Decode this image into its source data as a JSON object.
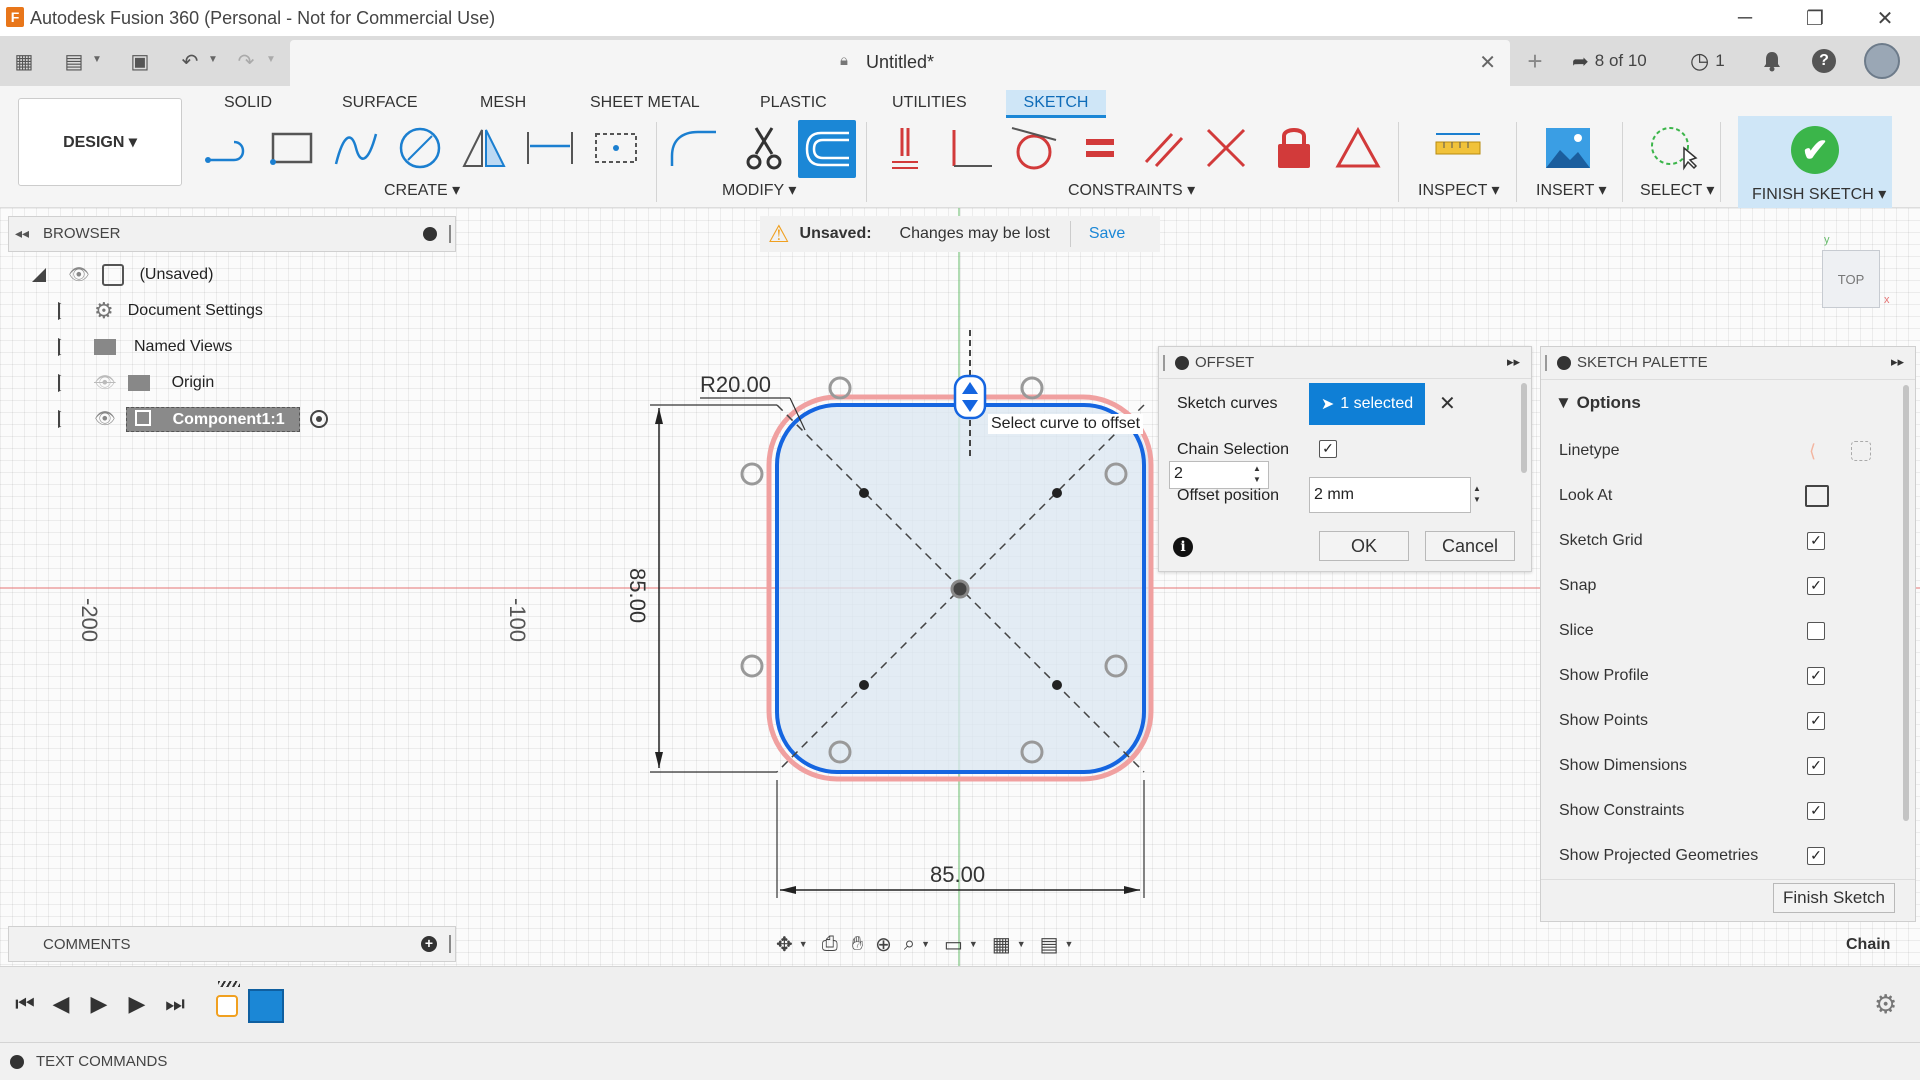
{
  "window": {
    "title": "Autodesk Fusion 360 (Personal - Not for Commercial Use)",
    "logo_letter": "F",
    "minimize": "─",
    "restore": "❐",
    "close": "✕"
  },
  "quick_access": {
    "grid_icon": "▦",
    "file_icon": "▤",
    "save_icon": "▣",
    "undo_icon": "↶",
    "redo_icon": "↷",
    "doc_title": "Untitled*",
    "doc_close": "✕",
    "new_tab": "+",
    "jobs": "8 of 10",
    "jobs_icon": "➦",
    "clock_count": "1",
    "clock_icon": "◷",
    "bell_icon": "🔔",
    "help_icon": "?",
    "avatar_icon": "●"
  },
  "ribbon": {
    "tabs": [
      "SOLID",
      "SURFACE",
      "MESH",
      "SHEET METAL",
      "PLASTIC",
      "UTILITIES",
      "SKETCH"
    ],
    "active_tab": "SKETCH",
    "workspace": "DESIGN ▾",
    "groups": {
      "create": "CREATE ▾",
      "modify": "MODIFY ▾",
      "constraints": "CONSTRAINTS ▾",
      "inspect": "INSPECT ▾",
      "insert": "INSERT ▾",
      "select": "SELECT ▾",
      "finish": "FINISH SKETCH ▾"
    },
    "check": "✔"
  },
  "browser": {
    "collapse_icon": "◂◂",
    "title": "BROWSER",
    "items": [
      {
        "label": "(Unsaved)"
      },
      {
        "label": "Document Settings"
      },
      {
        "label": "Named Views"
      },
      {
        "label": "Origin"
      },
      {
        "label": "Component1:1"
      }
    ]
  },
  "banner": {
    "warn_icon": "⚠",
    "title": "Unsaved:",
    "message": "Changes may be lost",
    "save": "Save"
  },
  "offset_dialog": {
    "title": "OFFSET",
    "sketch_curves_label": "Sketch curves",
    "selected": "1 selected",
    "clear": "✕",
    "chain_label": "Chain Selection",
    "chain_checked": true,
    "count_value": "2",
    "offset_label": "Offset position",
    "offset_value": "2 mm",
    "info_icon": "i",
    "ok": "OK",
    "cancel": "Cancel",
    "expand": "▸▸"
  },
  "palette": {
    "title": "SKETCH PALETTE",
    "section": "Options",
    "rows": [
      {
        "label": "Linetype",
        "type": "icons"
      },
      {
        "label": "Look At",
        "type": "icon"
      },
      {
        "label": "Sketch Grid",
        "checked": true
      },
      {
        "label": "Snap",
        "checked": true
      },
      {
        "label": "Slice",
        "checked": false
      },
      {
        "label": "Show Profile",
        "checked": true
      },
      {
        "label": "Show Points",
        "checked": true
      },
      {
        "label": "Show Dimensions",
        "checked": true
      },
      {
        "label": "Show Constraints",
        "checked": true
      },
      {
        "label": "Show Projected Geometries",
        "checked": true
      }
    ],
    "finish": "Finish Sketch",
    "check_mark": "✓",
    "expand": "▸▸"
  },
  "canvas": {
    "tooltip": "Select curve to offset",
    "dim_radius": "R20.00",
    "dim_vertical": "85.00",
    "dim_horizontal": "85.00",
    "ruler_left": "-200",
    "ruler_mid": "-100",
    "viewcube": "TOP",
    "chain_label": "Chain"
  },
  "comments": {
    "title": "COMMENTS",
    "add": "+"
  },
  "text_commands": {
    "title": "TEXT COMMANDS"
  },
  "colors": {
    "accent": "#1b87d6",
    "selected_bg": "#0f7fd6",
    "curve_blue": "#1565e0",
    "curve_red": "#f08a8a",
    "finish_green": "#3bb54a"
  }
}
